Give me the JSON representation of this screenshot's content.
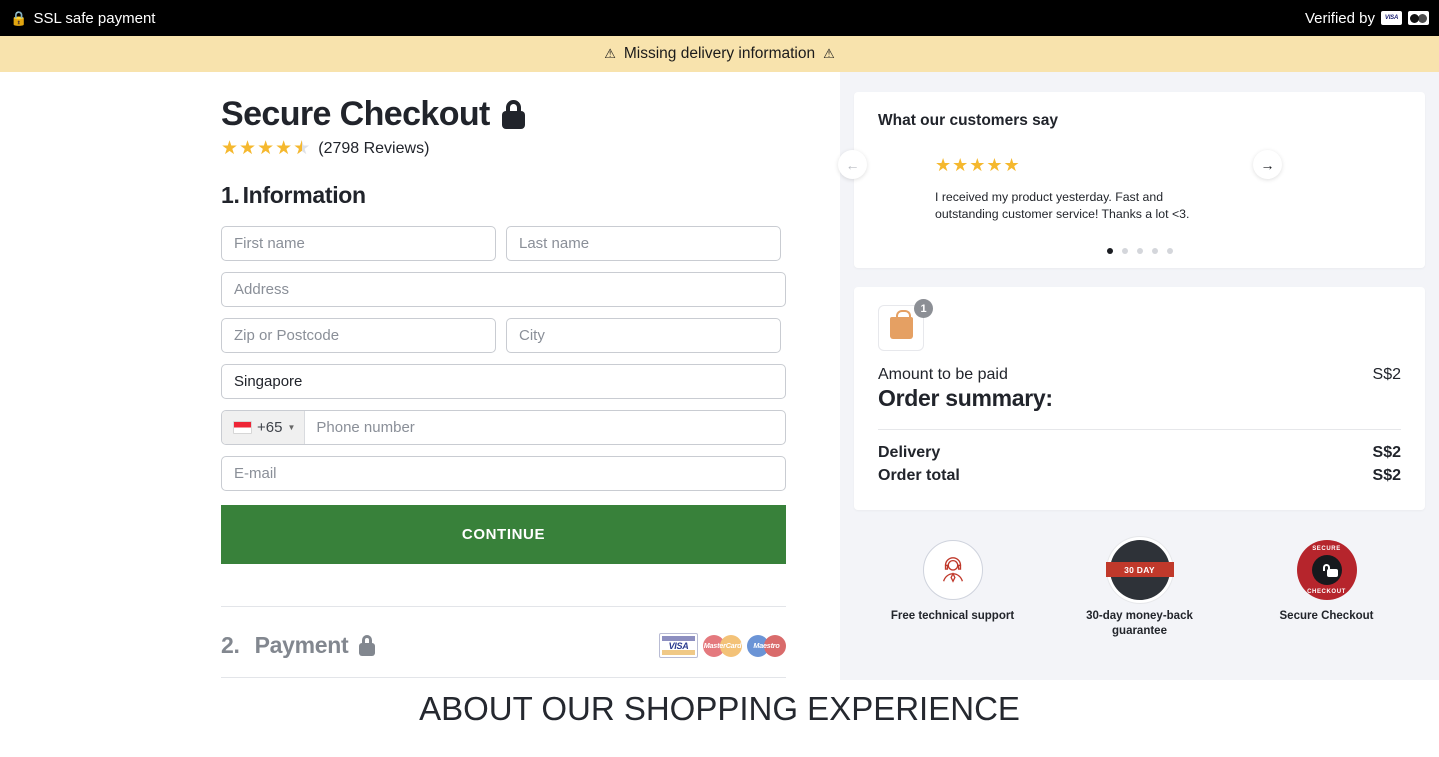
{
  "topbar": {
    "ssl_label": "SSL safe payment",
    "lock_icon": "lock-icon",
    "verified_label": "Verified by",
    "visa_label": "VISA",
    "mastercard_label": "mastercard-icon"
  },
  "warning": {
    "text": "Missing delivery information",
    "icon_left": "warning-triangle-icon",
    "icon_right": "warning-triangle-icon",
    "bg_color": "#f8e3ad"
  },
  "checkout": {
    "title": "Secure Checkout",
    "lock_icon": "lock-icon",
    "rating_value": 4.5,
    "reviews_text": "(2798 Reviews)",
    "star_color": "#f5b82e"
  },
  "information": {
    "heading_number": "1.",
    "heading_label": "Information",
    "fields": [
      {
        "name": "first-name",
        "placeholder": "First name",
        "value": ""
      },
      {
        "name": "last-name",
        "placeholder": "Last name",
        "value": ""
      },
      {
        "name": "address",
        "placeholder": "Address",
        "value": ""
      },
      {
        "name": "zip",
        "placeholder": "Zip or Postcode",
        "value": ""
      },
      {
        "name": "city",
        "placeholder": "City",
        "value": ""
      }
    ],
    "country_value": "Singapore",
    "phone": {
      "dial_code": "+65",
      "flag": "singapore-flag-icon",
      "placeholder": "Phone number",
      "value": ""
    },
    "email_placeholder": "E-mail",
    "continue_label": "CONTINUE",
    "continue_color": "#38813a"
  },
  "payment": {
    "heading_number": "2.",
    "heading_label": "Payment",
    "lock_icon": "lock-icon",
    "cards": [
      {
        "name": "visa",
        "label": "VISA"
      },
      {
        "name": "mastercard",
        "label": "MasterCard"
      },
      {
        "name": "maestro",
        "label": "Maestro"
      }
    ]
  },
  "testimonials": {
    "title": "What our customers say",
    "stars": "★★★★★",
    "text": "I received my product yesterday. Fast and outstanding customer service! Thanks a lot <3.",
    "dot_count": 5,
    "active_dot": 0,
    "prev_icon": "arrow-left-icon",
    "next_icon": "arrow-right-icon"
  },
  "order": {
    "bag_icon": "shopping-bag-icon",
    "item_count": "1",
    "amount_label": "Amount to be paid",
    "amount_value": "S$2",
    "summary_title": "Order summary:",
    "lines": [
      {
        "label": "Delivery",
        "value": "S$2"
      },
      {
        "label": "Order total",
        "value": "S$2"
      }
    ]
  },
  "trust": [
    {
      "name": "free-technical-support",
      "label": "Free technical support",
      "icon": "headset-agent-icon"
    },
    {
      "name": "money-back-guarantee",
      "label": "30-day money-back guarantee",
      "icon": "30-day-seal-icon",
      "ribbon": "30 DAY"
    },
    {
      "name": "secure-checkout-seal",
      "label": "Secure Checkout",
      "icon": "secure-checkout-seal-icon",
      "seal_top": "SECURE",
      "seal_bottom": "CHECKOUT"
    }
  ],
  "footer": {
    "heading": "ABOUT OUR SHOPPING EXPERIENCE"
  }
}
